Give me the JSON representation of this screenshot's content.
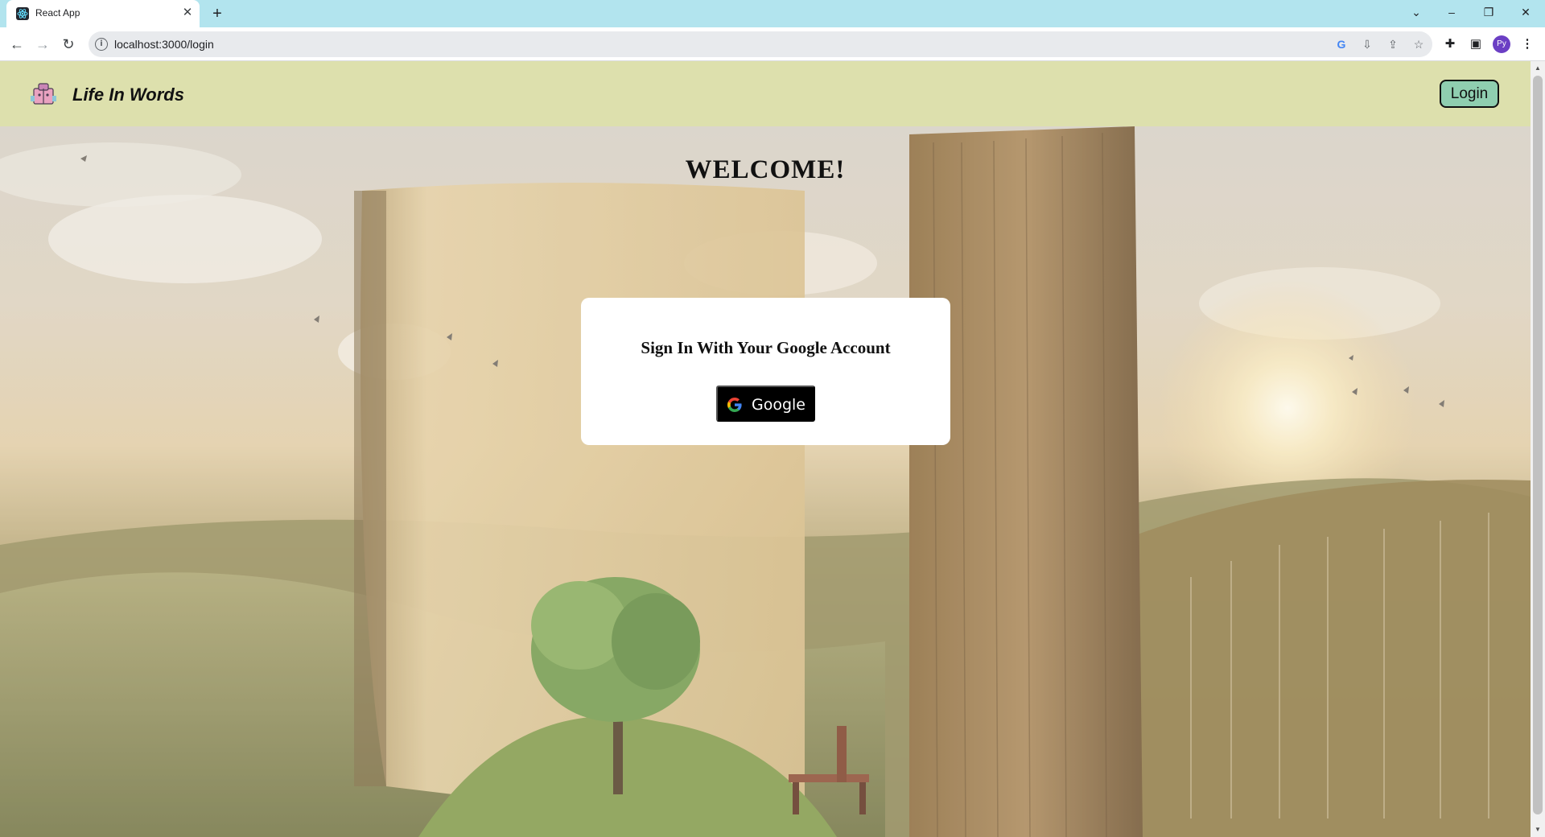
{
  "browser": {
    "tab_title": "React App",
    "tab_close": "✕",
    "new_tab": "+",
    "url": "localhost:3000/login",
    "profile_initials": "Py",
    "window_controls": {
      "dropdown": "⌄",
      "minimize": "–",
      "restore": "❐",
      "close": "✕"
    }
  },
  "navbar": {
    "brand": "Life In Words",
    "login_label": "Login",
    "background": "#dde0ad",
    "login_color": "#8fceb0"
  },
  "main": {
    "welcome": "WELCOME!",
    "card_title": "Sign In With Your Google Account",
    "google_button_label": "Google"
  },
  "icons": [
    "react-favicon-icon",
    "back-arrow-icon",
    "forward-arrow-icon",
    "reload-icon",
    "info-icon",
    "google-lens-icon",
    "install-icon",
    "share-icon",
    "star-icon",
    "extensions-icon",
    "side-panel-icon",
    "menu-icon",
    "logo-icon",
    "google-g-icon"
  ]
}
